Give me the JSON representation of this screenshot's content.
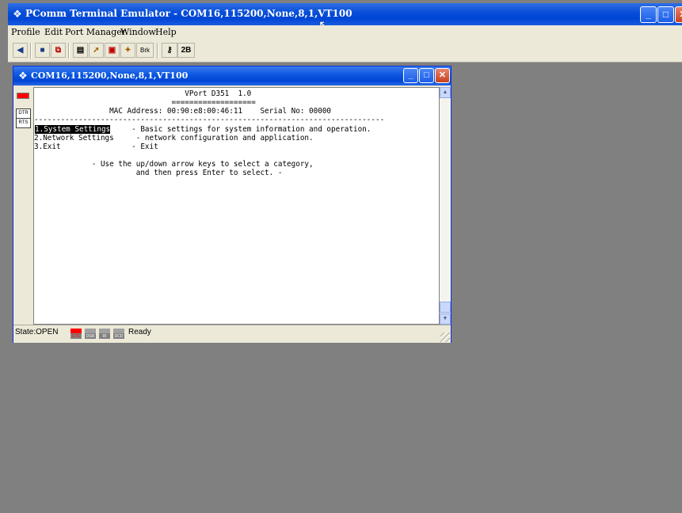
{
  "app": {
    "title": "PComm Terminal Emulator - COM16,115200,None,8,1,VT100",
    "icon": "pcomm-app-icon",
    "caption_buttons": [
      "minimize",
      "maximize",
      "close"
    ]
  },
  "menu": {
    "profile": "Profile",
    "edit": "Edit",
    "port_manager": "Port Manager",
    "window": "Window",
    "help": "Help"
  },
  "toolbar": {
    "icons": [
      "open-session-icon",
      "save-icon",
      "save-all-icon",
      "properties-icon",
      "transfer-icon",
      "capture-icon",
      "send-file-icon"
    ],
    "brk_label": "Brk",
    "two_b_label": "2B"
  },
  "terminal_window": {
    "title": "COM16,115200,None,8,1,VT100",
    "signals": {
      "dtr": "DTR",
      "rts": "RTS"
    }
  },
  "screen": {
    "lines": [
      "                                  VPort D351  1.0",
      "                               ===================",
      "                 MAC Address: 00:90:e8:00:46:11    Serial No: 00000",
      "-------------------------------------------------------------------------------",
      "1.System Settings",
      "                      - Basic settings for system information and operation.",
      "2.Network Settings     - network configuration and application.",
      "3.Exit                - Exit",
      "",
      "             - Use the up/down arrow keys to select a category,",
      "                       and then press Enter to select. -"
    ]
  },
  "status": {
    "state": "State:OPEN",
    "leds": [
      "CTS",
      "DSR",
      "RI",
      "DCD"
    ],
    "ready": "Ready"
  },
  "colors": {
    "titlebar": "#0046d5",
    "desktop": "#808080",
    "led_active": "#ff0000"
  }
}
